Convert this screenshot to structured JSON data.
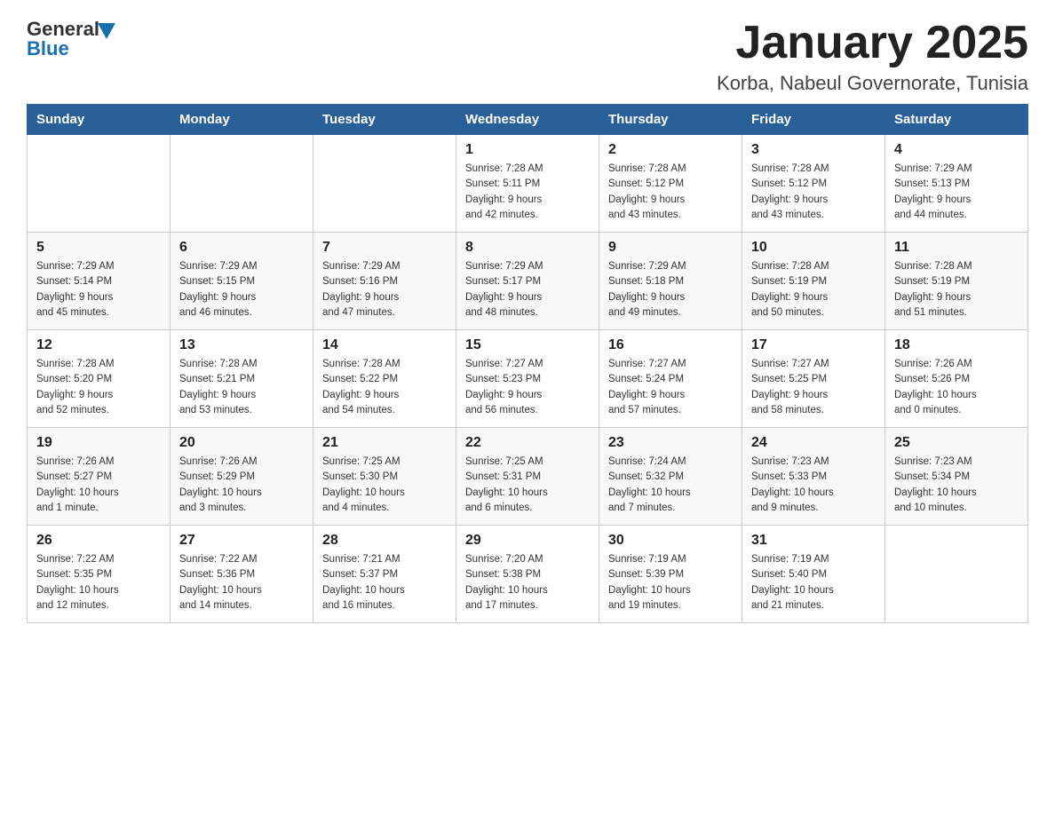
{
  "logo": {
    "text_general": "General",
    "text_blue": "Blue"
  },
  "header": {
    "title": "January 2025",
    "location": "Korba, Nabeul Governorate, Tunisia"
  },
  "days_of_week": [
    "Sunday",
    "Monday",
    "Tuesday",
    "Wednesday",
    "Thursday",
    "Friday",
    "Saturday"
  ],
  "weeks": [
    [
      {
        "day": "",
        "info": ""
      },
      {
        "day": "",
        "info": ""
      },
      {
        "day": "",
        "info": ""
      },
      {
        "day": "1",
        "info": "Sunrise: 7:28 AM\nSunset: 5:11 PM\nDaylight: 9 hours\nand 42 minutes."
      },
      {
        "day": "2",
        "info": "Sunrise: 7:28 AM\nSunset: 5:12 PM\nDaylight: 9 hours\nand 43 minutes."
      },
      {
        "day": "3",
        "info": "Sunrise: 7:28 AM\nSunset: 5:12 PM\nDaylight: 9 hours\nand 43 minutes."
      },
      {
        "day": "4",
        "info": "Sunrise: 7:29 AM\nSunset: 5:13 PM\nDaylight: 9 hours\nand 44 minutes."
      }
    ],
    [
      {
        "day": "5",
        "info": "Sunrise: 7:29 AM\nSunset: 5:14 PM\nDaylight: 9 hours\nand 45 minutes."
      },
      {
        "day": "6",
        "info": "Sunrise: 7:29 AM\nSunset: 5:15 PM\nDaylight: 9 hours\nand 46 minutes."
      },
      {
        "day": "7",
        "info": "Sunrise: 7:29 AM\nSunset: 5:16 PM\nDaylight: 9 hours\nand 47 minutes."
      },
      {
        "day": "8",
        "info": "Sunrise: 7:29 AM\nSunset: 5:17 PM\nDaylight: 9 hours\nand 48 minutes."
      },
      {
        "day": "9",
        "info": "Sunrise: 7:29 AM\nSunset: 5:18 PM\nDaylight: 9 hours\nand 49 minutes."
      },
      {
        "day": "10",
        "info": "Sunrise: 7:28 AM\nSunset: 5:19 PM\nDaylight: 9 hours\nand 50 minutes."
      },
      {
        "day": "11",
        "info": "Sunrise: 7:28 AM\nSunset: 5:19 PM\nDaylight: 9 hours\nand 51 minutes."
      }
    ],
    [
      {
        "day": "12",
        "info": "Sunrise: 7:28 AM\nSunset: 5:20 PM\nDaylight: 9 hours\nand 52 minutes."
      },
      {
        "day": "13",
        "info": "Sunrise: 7:28 AM\nSunset: 5:21 PM\nDaylight: 9 hours\nand 53 minutes."
      },
      {
        "day": "14",
        "info": "Sunrise: 7:28 AM\nSunset: 5:22 PM\nDaylight: 9 hours\nand 54 minutes."
      },
      {
        "day": "15",
        "info": "Sunrise: 7:27 AM\nSunset: 5:23 PM\nDaylight: 9 hours\nand 56 minutes."
      },
      {
        "day": "16",
        "info": "Sunrise: 7:27 AM\nSunset: 5:24 PM\nDaylight: 9 hours\nand 57 minutes."
      },
      {
        "day": "17",
        "info": "Sunrise: 7:27 AM\nSunset: 5:25 PM\nDaylight: 9 hours\nand 58 minutes."
      },
      {
        "day": "18",
        "info": "Sunrise: 7:26 AM\nSunset: 5:26 PM\nDaylight: 10 hours\nand 0 minutes."
      }
    ],
    [
      {
        "day": "19",
        "info": "Sunrise: 7:26 AM\nSunset: 5:27 PM\nDaylight: 10 hours\nand 1 minute."
      },
      {
        "day": "20",
        "info": "Sunrise: 7:26 AM\nSunset: 5:29 PM\nDaylight: 10 hours\nand 3 minutes."
      },
      {
        "day": "21",
        "info": "Sunrise: 7:25 AM\nSunset: 5:30 PM\nDaylight: 10 hours\nand 4 minutes."
      },
      {
        "day": "22",
        "info": "Sunrise: 7:25 AM\nSunset: 5:31 PM\nDaylight: 10 hours\nand 6 minutes."
      },
      {
        "day": "23",
        "info": "Sunrise: 7:24 AM\nSunset: 5:32 PM\nDaylight: 10 hours\nand 7 minutes."
      },
      {
        "day": "24",
        "info": "Sunrise: 7:23 AM\nSunset: 5:33 PM\nDaylight: 10 hours\nand 9 minutes."
      },
      {
        "day": "25",
        "info": "Sunrise: 7:23 AM\nSunset: 5:34 PM\nDaylight: 10 hours\nand 10 minutes."
      }
    ],
    [
      {
        "day": "26",
        "info": "Sunrise: 7:22 AM\nSunset: 5:35 PM\nDaylight: 10 hours\nand 12 minutes."
      },
      {
        "day": "27",
        "info": "Sunrise: 7:22 AM\nSunset: 5:36 PM\nDaylight: 10 hours\nand 14 minutes."
      },
      {
        "day": "28",
        "info": "Sunrise: 7:21 AM\nSunset: 5:37 PM\nDaylight: 10 hours\nand 16 minutes."
      },
      {
        "day": "29",
        "info": "Sunrise: 7:20 AM\nSunset: 5:38 PM\nDaylight: 10 hours\nand 17 minutes."
      },
      {
        "day": "30",
        "info": "Sunrise: 7:19 AM\nSunset: 5:39 PM\nDaylight: 10 hours\nand 19 minutes."
      },
      {
        "day": "31",
        "info": "Sunrise: 7:19 AM\nSunset: 5:40 PM\nDaylight: 10 hours\nand 21 minutes."
      },
      {
        "day": "",
        "info": ""
      }
    ]
  ]
}
